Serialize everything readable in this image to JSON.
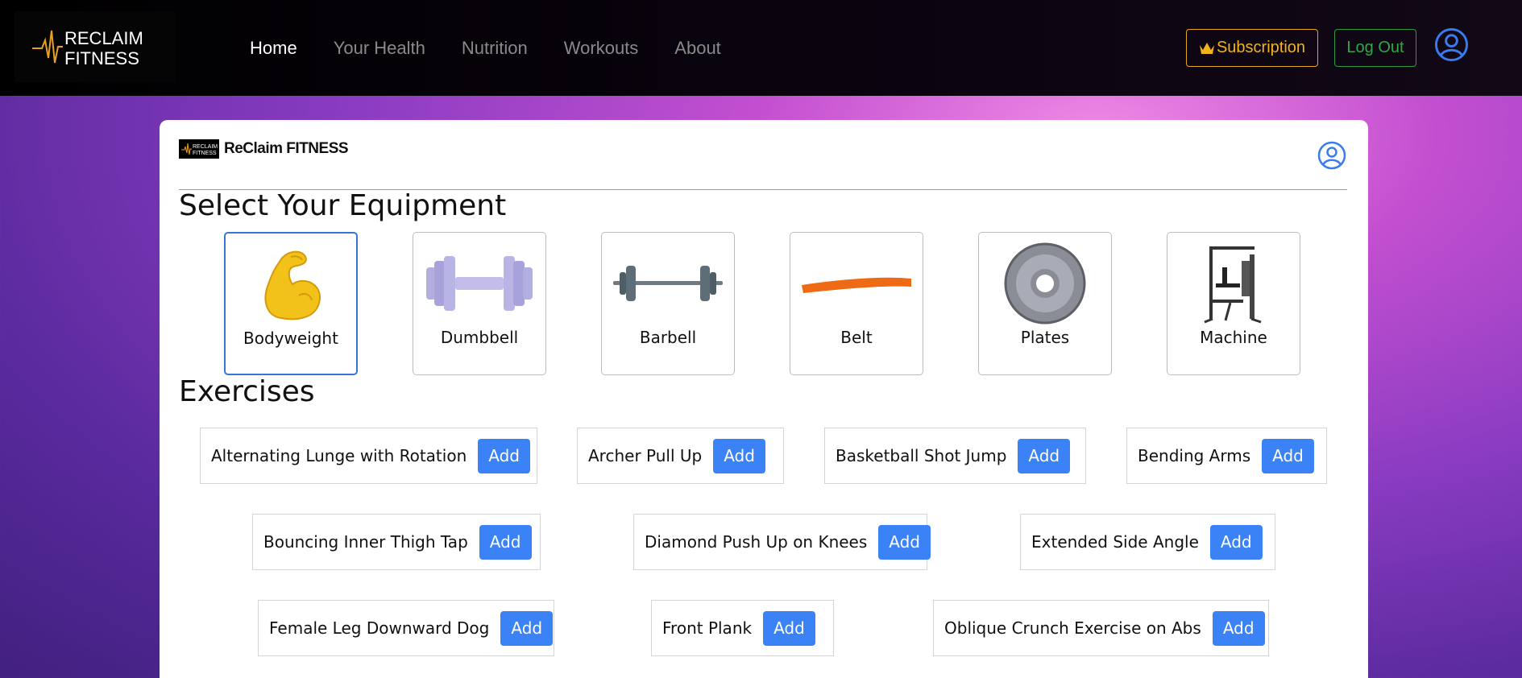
{
  "nav": {
    "brand_line1": "RECLAIM",
    "brand_line2": "FITNESS",
    "links": [
      "Home",
      "Your Health",
      "Nutrition",
      "Workouts",
      "About"
    ],
    "subscription_label": "Subscription",
    "logout_label": "Log Out"
  },
  "card": {
    "brand_title": "ReClaim FITNESS",
    "equipment_heading": "Select Your Equipment",
    "exercises_heading": "Exercises",
    "equipment": [
      {
        "label": "Bodyweight",
        "icon": "flexed-bicep-icon",
        "selected": true
      },
      {
        "label": "Dumbbell",
        "icon": "dumbbell-icon",
        "selected": false
      },
      {
        "label": "Barbell",
        "icon": "barbell-icon",
        "selected": false
      },
      {
        "label": "Belt",
        "icon": "resistance-band-icon",
        "selected": false
      },
      {
        "label": "Plates",
        "icon": "weight-plate-icon",
        "selected": false
      },
      {
        "label": "Machine",
        "icon": "gym-machine-icon",
        "selected": false
      }
    ],
    "add_label": "Add",
    "exercises": [
      "Alternating Lunge with Rotation",
      "Archer Pull Up",
      "Basketball Shot Jump",
      "Bending Arms",
      "Bouncing Inner Thigh Tap",
      "Diamond Push Up on Knees",
      "Extended Side Angle",
      "Female Leg Downward Dog",
      "Front Plank",
      "Oblique Crunch Exercise on Abs"
    ]
  },
  "colors": {
    "accent": "#3b82f6",
    "subscription": "#f0b41a",
    "logout": "#2eaa44",
    "selected_border": "#3a73d6"
  }
}
